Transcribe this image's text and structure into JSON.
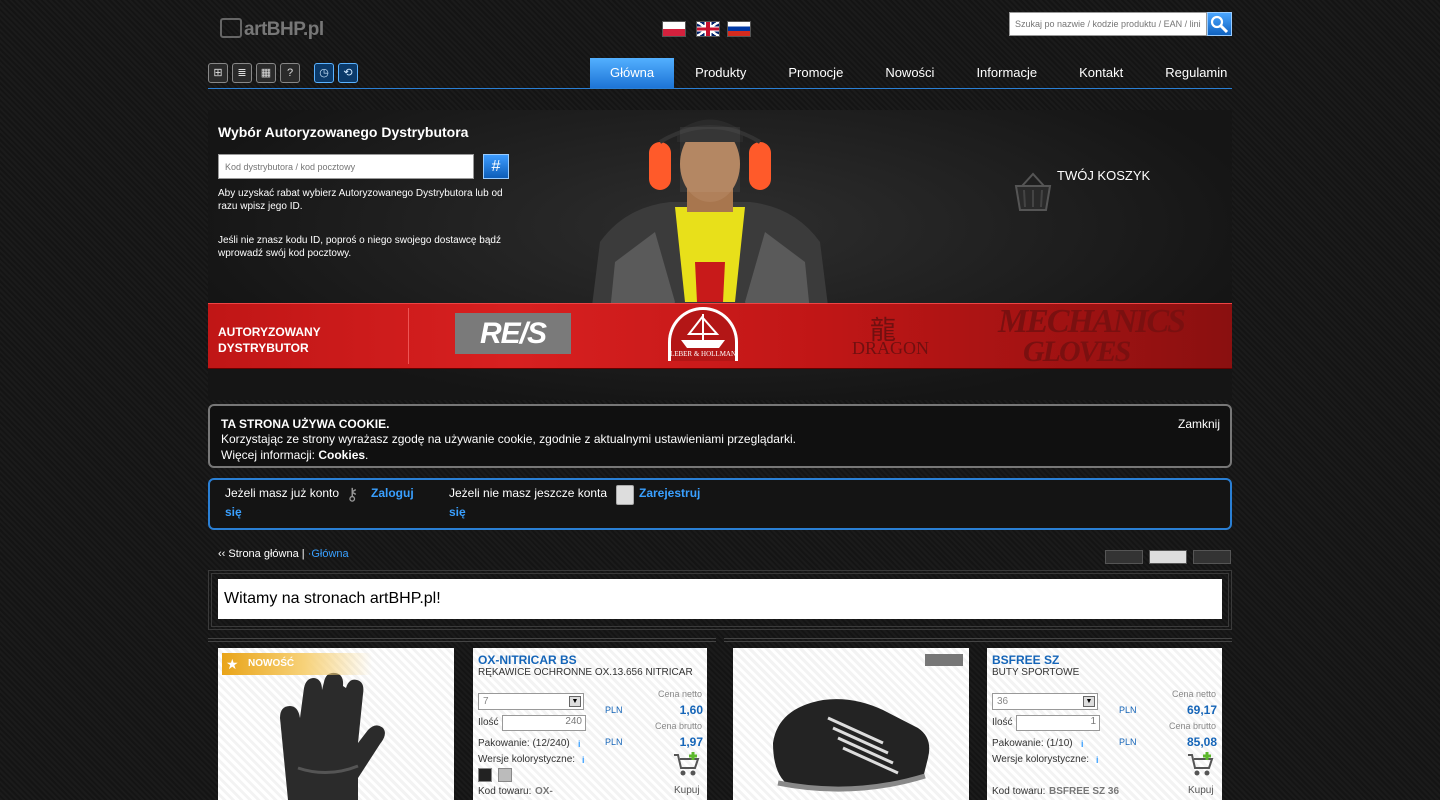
{
  "header": {
    "logo": "artBHP.pl",
    "search_placeholder": "Szukaj po nazwie / kodzie produktu / EAN / linii",
    "languages": [
      "polski",
      "english",
      "русский"
    ]
  },
  "toolbar": {
    "icons": [
      "sitemap-icon",
      "document-icon",
      "calculator-icon",
      "help-icon",
      "clock-icon",
      "search-history-icon"
    ]
  },
  "nav": {
    "items": [
      "Główna",
      "Produkty",
      "Promocje",
      "Nowości",
      "Informacje",
      "Kontakt",
      "Regulamin"
    ],
    "active": "Główna"
  },
  "distributor": {
    "title": "Wybór Autoryzowanego Dystrybutora",
    "placeholder": "Kod dystrybutora / kod pocztowy",
    "hash": "#",
    "note1": "Aby uzyskać rabat wybierz Autoryzowanego Dystrybutora lub od razu wpisz jego ID.",
    "note2": "Jeśli nie znasz kodu ID, poproś o niego swojego dostawcę bądź wprowadź swój kod pocztowy."
  },
  "cart": {
    "label": "TWÓJ KOSZYK"
  },
  "band": {
    "label_line1": "AUTORYZOWANY",
    "label_line2": "DYSTRYBUTOR",
    "brands": [
      "REIS",
      "Leber & Hollman",
      "Dragon",
      "Mechanics Gloves"
    ],
    "reis_text": "RE/S",
    "leber_text": "LEBER & HOLLMAN",
    "dragon_text": "DRAGON",
    "mech_line1": "MECHANICS",
    "mech_line2": "GLOVES"
  },
  "cookie": {
    "title": "TA STRONA UŻYWA COOKIE.",
    "line1": "Korzystając ze strony wyrażasz zgodę na używanie cookie, zgodnie z aktualnymi ustawieniami przeglądarki.",
    "more_prefix": "Więcej informacji: ",
    "more_link": "Cookies",
    "close": "Zamknij"
  },
  "login": {
    "have_account": "Jeżeli masz już konto",
    "login_a": "Zaloguj",
    "login_b": "się",
    "no_account": "Jeżeli nie masz jeszcze konta",
    "register_a": "Zarejestruj",
    "register_b": "się"
  },
  "breadcrumb": {
    "prefix": "‹‹ Strona główna |",
    "current": "·Główna"
  },
  "welcome": "Witamy na stronach artBHP.pl!",
  "products": [
    {
      "badge": "NOWOŚĆ",
      "name": "OX-NITRICAR BS",
      "subtitle": "RĘKAWICE OCHRONNE OX.13.656 NITRICAR",
      "size": "7",
      "qty_label": "Ilość",
      "qty": "240",
      "packaging": "Pakowanie: (12/240)",
      "variants": "Wersje kolorystyczne:",
      "code_label": "Kod towaru:",
      "code": "OX-",
      "net_label": "Cena netto",
      "net": "1,60",
      "gross_label": "Cena brutto",
      "gross": "1,97",
      "currency": "PLN",
      "buy": "Kupuj"
    },
    {
      "name": "BSFREE SZ",
      "subtitle": "BUTY SPORTOWE",
      "size": "36",
      "qty_label": "Ilość",
      "qty": "1",
      "packaging": "Pakowanie: (1/10)",
      "variants": "Wersje kolorystyczne:",
      "code_label": "Kod towaru:",
      "code": "BSFREE SZ 36",
      "net_label": "Cena netto",
      "net": "69,17",
      "gross_label": "Cena brutto",
      "gross": "85,08",
      "currency": "PLN",
      "buy": "Kupuj"
    }
  ],
  "colors": {
    "accent": "#2a7fd4",
    "band": "#c81a1a",
    "price": "#1565b8"
  }
}
